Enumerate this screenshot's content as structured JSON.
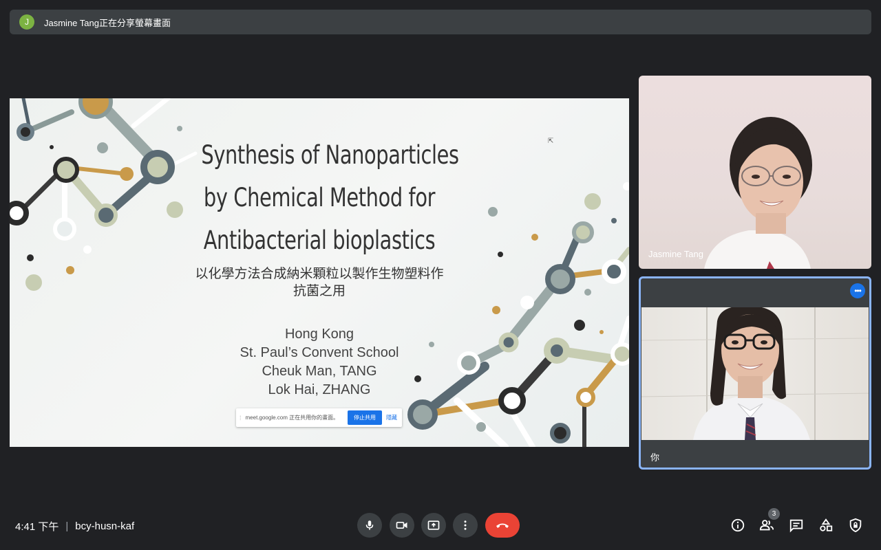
{
  "banner": {
    "avatar_initial": "J",
    "text": "Jasmine Tang正在分享螢幕畫面"
  },
  "slide": {
    "title_lines": [
      "Synthesis of Nanoparticles",
      "by Chemical Method for",
      "Antibacterial bioplastics"
    ],
    "subtitle_lines": [
      "以化學方法合成納米顆粒以製作生物塑料作",
      "抗菌之用"
    ],
    "authors": [
      "Hong Kong",
      "St. Paul’s Convent School",
      "Cheuk Man, TANG",
      "Lok Hai, ZHANG"
    ]
  },
  "share_bar": {
    "text": "meet.google.com 正在共用你的畫面。",
    "stop_label": "停止共用",
    "hide_label": "隱藏"
  },
  "participants": {
    "jasmine": {
      "name": "Jasmine Tang"
    },
    "you": {
      "name": "你"
    }
  },
  "footer": {
    "time": "4:41 下午",
    "separator": "|",
    "meeting_code": "bcy-husn-kaf",
    "people_count": "3"
  },
  "icons": {
    "mic": "microphone-icon",
    "camera": "videocam-icon",
    "present": "present-screen-icon",
    "more": "more-vert-icon",
    "end": "call-end-icon",
    "info": "info-icon",
    "people": "people-icon",
    "chat": "chat-icon",
    "activities": "activities-icon",
    "host": "host-controls-icon"
  },
  "colors": {
    "accent": "#1a73e8",
    "end_call": "#ea4335",
    "background": "#202124",
    "tile_highlight": "#8ab4f8"
  }
}
